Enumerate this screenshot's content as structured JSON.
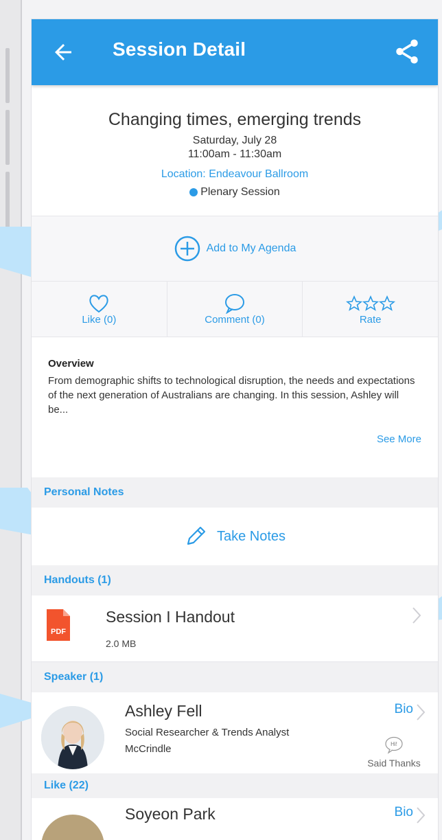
{
  "appbar": {
    "title": "Session Detail"
  },
  "session": {
    "title": "Changing times, emerging trends",
    "date": "Saturday, July 28",
    "time": "11:00am - 11:30am",
    "location": "Location: Endeavour Ballroom",
    "track": "Plenary Session"
  },
  "agenda": {
    "label": "Add to My Agenda"
  },
  "actions": {
    "like": "Like (0)",
    "comment": "Comment (0)",
    "rate": "Rate"
  },
  "overview": {
    "heading": "Overview",
    "text": "From demographic shifts to technological disruption, the needs and expectations of the next generation of Australians are changing. In this session, Ashley will be...",
    "see_more": "See More"
  },
  "notes": {
    "header": "Personal Notes",
    "take_notes": "Take Notes"
  },
  "handouts": {
    "header": "Handouts (1)",
    "items": [
      {
        "name": "Session I Handout",
        "size": "2.0 MB",
        "type": "PDF"
      }
    ]
  },
  "speakers": {
    "header": "Speaker (1)",
    "items": [
      {
        "name": "Ashley Fell",
        "role": "Social Researcher & Trends Analyst",
        "org": "McCrindle",
        "bio": "Bio",
        "thanks": "Said Thanks",
        "bubble": "Hi!"
      }
    ]
  },
  "likes": {
    "header": "Like (22)",
    "items": [
      {
        "name": "Soyeon Park",
        "bio": "Bio"
      }
    ]
  },
  "colors": {
    "accent": "#2b9be6",
    "pdf": "#f2542d"
  }
}
